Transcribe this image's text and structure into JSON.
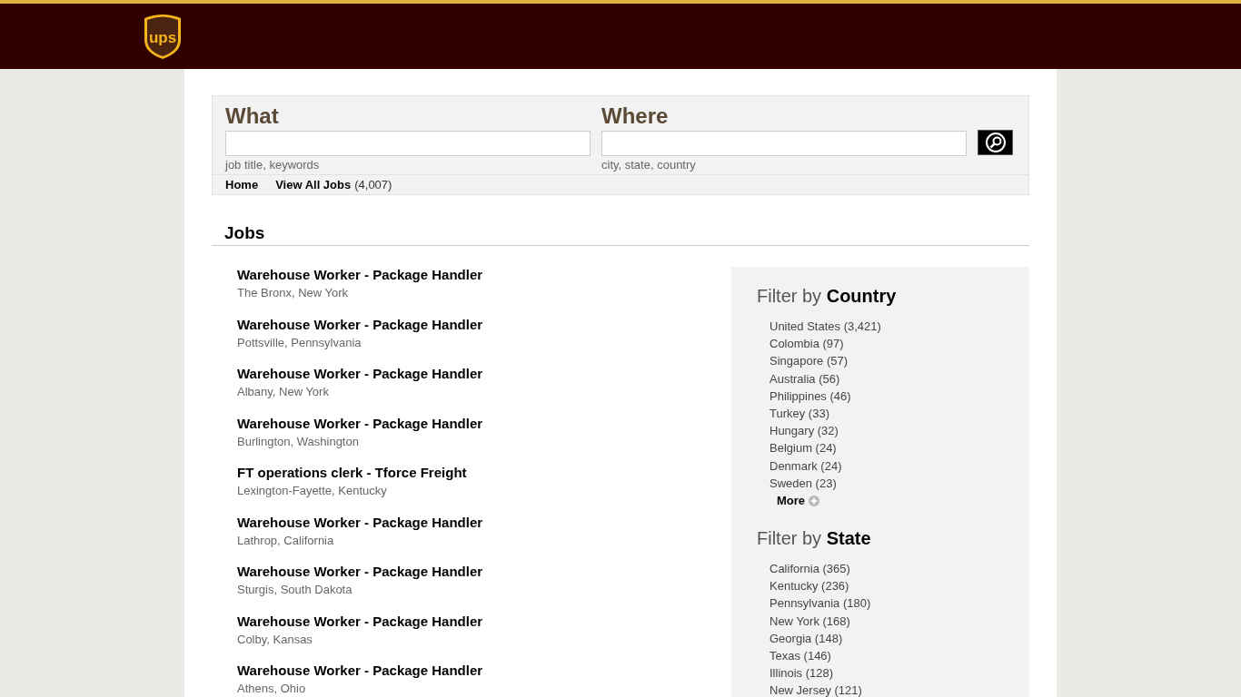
{
  "header": {
    "logo_text": "ups"
  },
  "search": {
    "what": {
      "label": "What",
      "hint": "job title, keywords"
    },
    "where": {
      "label": "Where",
      "hint": "city, state, country"
    }
  },
  "breadcrumbs": [
    {
      "label": "Home"
    },
    {
      "label": "View All Jobs",
      "count": "(4,007)"
    }
  ],
  "jobs_heading": "Jobs",
  "jobs": [
    {
      "title": "Warehouse Worker - Package Handler",
      "location": "The Bronx, New York"
    },
    {
      "title": "Warehouse Worker - Package Handler",
      "location": "Pottsville, Pennsylvania"
    },
    {
      "title": "Warehouse Worker - Package Handler",
      "location": "Albany, New York"
    },
    {
      "title": "Warehouse Worker - Package Handler",
      "location": "Burlington, Washington"
    },
    {
      "title": "FT operations clerk - Tforce Freight",
      "location": "Lexington-Fayette, Kentucky"
    },
    {
      "title": "Warehouse Worker - Package Handler",
      "location": "Lathrop, California"
    },
    {
      "title": "Warehouse Worker - Package Handler",
      "location": "Sturgis, South Dakota"
    },
    {
      "title": "Warehouse Worker - Package Handler",
      "location": "Colby, Kansas"
    },
    {
      "title": "Warehouse Worker - Package Handler",
      "location": "Athens, Ohio"
    }
  ],
  "filters": [
    {
      "title": "Filter by **Country**",
      "items": [
        "United States (3,421)",
        "Colombia (97)",
        "Singapore (57)",
        "Australia (56)",
        "Philippines (46)",
        "Turkey (33)",
        "Hungary (32)",
        "Belgium (24)",
        "Denmark (24)",
        "Sweden (23)"
      ],
      "more": "More"
    },
    {
      "title": "Filter by **State**",
      "items": [
        "California (365)",
        "Kentucky (236)",
        "Pennsylvania (180)",
        "New York (168)",
        "Georgia (148)",
        "Texas (146)",
        "Illinois (128)",
        "New Jersey (121)"
      ]
    }
  ]
}
